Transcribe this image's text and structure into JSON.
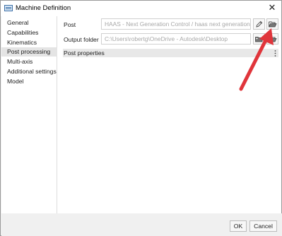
{
  "window": {
    "title": "Machine Definition",
    "close_glyph": "✕"
  },
  "sidebar": {
    "items": [
      {
        "label": "General",
        "active": false
      },
      {
        "label": "Capabilities",
        "active": false
      },
      {
        "label": "Kinematics",
        "active": false
      },
      {
        "label": "Post processing",
        "active": true
      },
      {
        "label": "Multi-axis",
        "active": false
      },
      {
        "label": "Additional settings",
        "active": false
      },
      {
        "label": "Model",
        "active": false
      }
    ]
  },
  "form": {
    "post_label": "Post",
    "post_value": "HAAS - Next Generation Control / haas next generation",
    "output_label": "Output folder",
    "output_value": "C:\\Users\\robertg\\OneDrive - Autodesk\\Desktop",
    "properties_label": "Post properties"
  },
  "icons": {
    "edit": "pencil-icon",
    "folder": "folder-open-icon",
    "folder_new": "folder-new-icon",
    "more": "more-vertical-icon"
  },
  "annotation": {
    "arrow_color": "#e0353b"
  },
  "footer": {
    "ok_label": "OK",
    "cancel_label": "Cancel"
  }
}
